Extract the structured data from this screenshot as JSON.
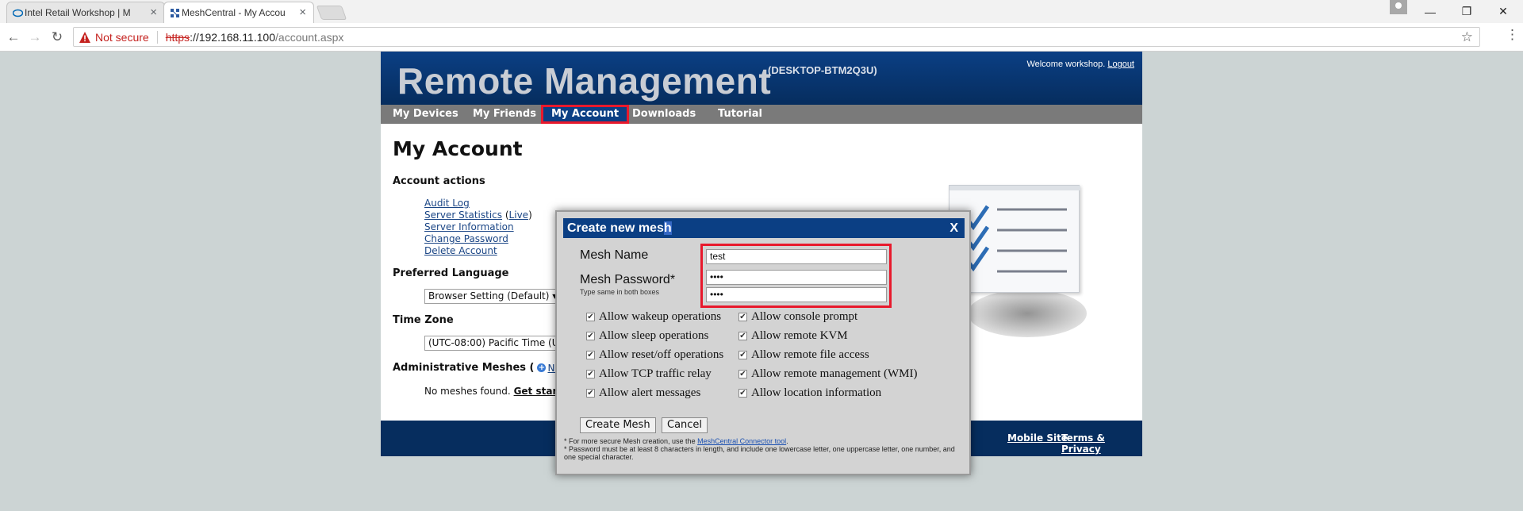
{
  "browser": {
    "tabs": [
      {
        "title": "Intel Retail Workshop | M"
      },
      {
        "title": "MeshCentral - My Accou"
      }
    ],
    "security_label": "Not secure",
    "url_scheme": "https",
    "url_host": "://192.168.11.100",
    "url_path": "/account.aspx"
  },
  "header": {
    "title": "Remote Management",
    "machine": "(DESKTOP-BTM2Q3U)",
    "welcome": "Welcome workshop.",
    "logout": "Logout"
  },
  "nav": {
    "items": [
      {
        "label": "My Devices"
      },
      {
        "label": "My Friends"
      },
      {
        "label": "My Account"
      },
      {
        "label": "Downloads"
      },
      {
        "label": "Tutorial"
      }
    ]
  },
  "page": {
    "title": "My Account",
    "account_actions": "Account actions",
    "audit_log": "Audit Log",
    "server_statistics": "Server Statistics",
    "live_open": "(",
    "live": "Live",
    "live_close": ")",
    "server_information": "Server Information",
    "change_password": "Change Password",
    "delete_account": "Delete Account",
    "preferred_language": "Preferred Language",
    "language_value": "Browser Setting (Default)",
    "time_zone": "Time Zone",
    "timezone_value": "(UTC-08:00) Pacific Time (U",
    "admin_meshes": "Administrative Meshes (",
    "new": "New",
    "admin_close": ")",
    "no_meshes": "No meshes found.",
    "get_started": "Get starte"
  },
  "footer": {
    "mobile": "Mobile Site",
    "terms": "Terms & Privacy"
  },
  "dialog": {
    "title_a": "Create new mes",
    "title_b": "h",
    "close": "X",
    "mesh_name_label": "Mesh Name",
    "mesh_name_value": "test",
    "mesh_password_label": "Mesh Password*",
    "password_note": "Type same in both boxes",
    "password_value": "••••",
    "password_confirm_value": "••••",
    "options_left": [
      "Allow wakeup operations",
      "Allow sleep operations",
      "Allow reset/off operations",
      "Allow TCP traffic relay",
      "Allow alert messages"
    ],
    "options_right": [
      "Allow console prompt",
      "Allow remote KVM",
      "Allow remote file access",
      "Allow remote management (WMI)",
      "Allow location information"
    ],
    "create_button": "Create Mesh",
    "cancel_button": "Cancel",
    "note1_prefix": "* For more secure Mesh creation, use the",
    "note1_link": "MeshCentral Connector tool",
    "note1_suffix": ".",
    "note2": "* Password must be at least 8 characters in length, and include one lowercase letter, one uppercase letter, one number, and one special character."
  },
  "colors": {
    "header_blue": "#0b3f84",
    "highlight_red": "#e8192c",
    "nav_gray": "#7a7a7a"
  }
}
